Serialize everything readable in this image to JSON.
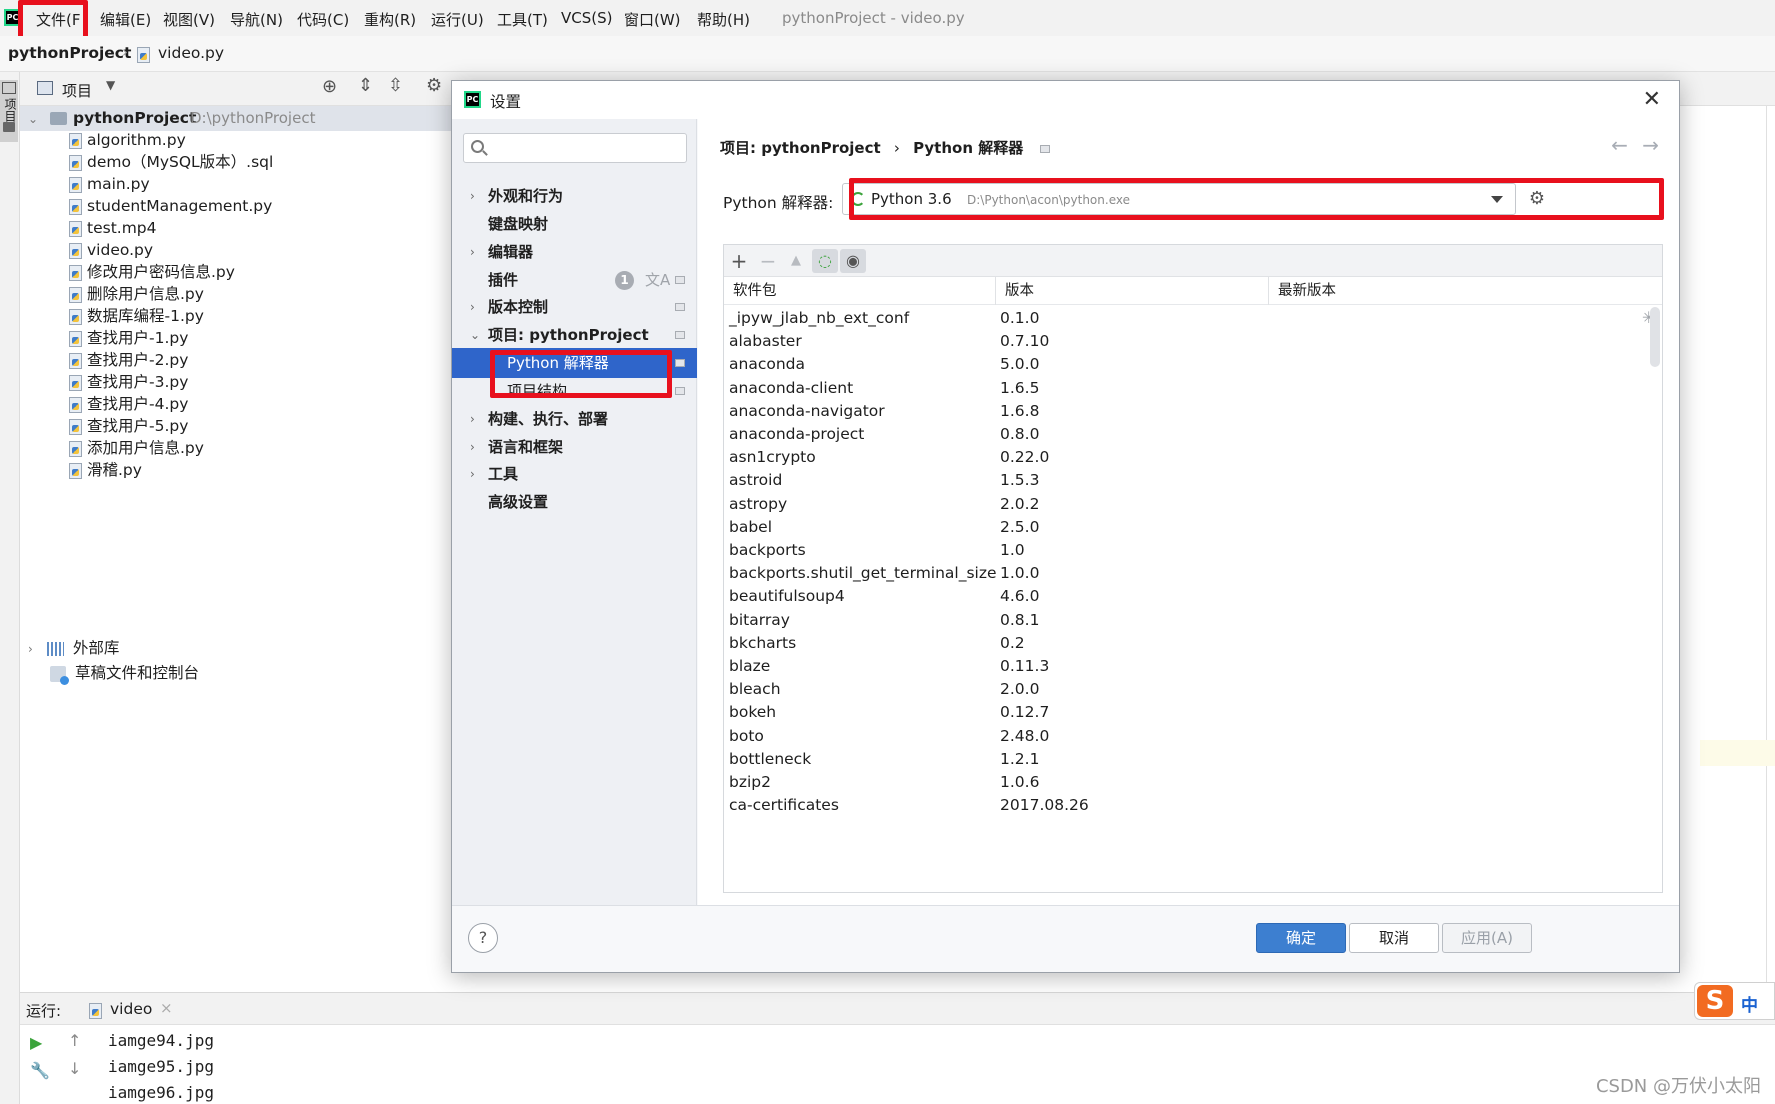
{
  "menubar": {
    "items": [
      "文件(F",
      "编辑(E)",
      "视图(V)",
      "导航(N)",
      "代码(C)",
      "重构(R)",
      "运行(U)",
      "工具(T)",
      "VCS(S)",
      "窗口(W)",
      "帮助(H)"
    ],
    "window_title": "pythonProject - video.py"
  },
  "navbar": {
    "project": "pythonProject",
    "file": "video.py"
  },
  "toolstrip": {
    "tab": "项目"
  },
  "project_panel": {
    "header": "项目",
    "root_name": "pythonProject",
    "root_path": "D:\\pythonProject",
    "files": [
      "algorithm.py",
      "demo（MySQL版本）.sql",
      "main.py",
      "studentManagement.py",
      "test.mp4",
      "video.py",
      "修改用户密码信息.py",
      "删除用户信息.py",
      "数据库编程-1.py",
      "查找用户-1.py",
      "查找用户-2.py",
      "查找用户-3.py",
      "查找用户-4.py",
      "查找用户-5.py",
      "添加用户信息.py",
      "滑稽.py"
    ],
    "external_libs": "外部库",
    "scratches": "草稿文件和控制台"
  },
  "run_panel": {
    "label": "运行:",
    "tab": "video",
    "lines": [
      "iamge94.jpg",
      "iamge95.jpg",
      "iamge96.jpg"
    ]
  },
  "dialog": {
    "title": "设置",
    "nav": {
      "appearance": "外观和行为",
      "keymap": "键盘映射",
      "editor": "编辑器",
      "plugins": "插件",
      "plugins_badge": "1",
      "vcs": "版本控制",
      "project": "项目: pythonProject",
      "interpreter": "Python 解释器",
      "structure": "项目结构",
      "build": "构建、执行、部署",
      "languages": "语言和框架",
      "tools": "工具",
      "advanced": "高级设置"
    },
    "breadcrumb": {
      "parent": "项目: pythonProject",
      "sep": "›",
      "current": "Python 解释器"
    },
    "interpreter": {
      "label": "Python 解释器:",
      "value": "Python 3.6",
      "path": "D:\\Python\\acon\\python.exe"
    },
    "table": {
      "headers": [
        "软件包",
        "版本",
        "最新版本"
      ],
      "rows": [
        [
          "_ipyw_jlab_nb_ext_conf",
          "0.1.0"
        ],
        [
          "alabaster",
          "0.7.10"
        ],
        [
          "anaconda",
          "5.0.0"
        ],
        [
          "anaconda-client",
          "1.6.5"
        ],
        [
          "anaconda-navigator",
          "1.6.8"
        ],
        [
          "anaconda-project",
          "0.8.0"
        ],
        [
          "asn1crypto",
          "0.22.0"
        ],
        [
          "astroid",
          "1.5.3"
        ],
        [
          "astropy",
          "2.0.2"
        ],
        [
          "babel",
          "2.5.0"
        ],
        [
          "backports",
          "1.0"
        ],
        [
          "backports.shutil_get_terminal_size",
          "1.0.0"
        ],
        [
          "beautifulsoup4",
          "4.6.0"
        ],
        [
          "bitarray",
          "0.8.1"
        ],
        [
          "bkcharts",
          "0.2"
        ],
        [
          "blaze",
          "0.11.3"
        ],
        [
          "bleach",
          "2.0.0"
        ],
        [
          "bokeh",
          "0.12.7"
        ],
        [
          "boto",
          "2.48.0"
        ],
        [
          "bottleneck",
          "1.2.1"
        ],
        [
          "bzip2",
          "1.0.6"
        ],
        [
          "ca-certificates",
          "2017.08.26"
        ]
      ]
    },
    "buttons": {
      "ok": "确定",
      "cancel": "取消",
      "apply": "应用(A)",
      "help": "?"
    }
  },
  "ime": {
    "logo": "S",
    "mode": "中"
  },
  "watermark": "CSDN @万伏小太阳",
  "colors": {
    "highlight_red": "#e8101d",
    "selection_blue": "#2f65ca",
    "primary_button": "#3d7fd0"
  }
}
